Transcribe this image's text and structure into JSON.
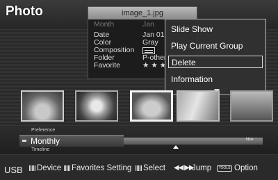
{
  "app": {
    "title": "Photo"
  },
  "file_info": {
    "filename": "image_1.jpg",
    "header_left": "Month",
    "header_right": "Jan",
    "rows": [
      {
        "label": "Date",
        "value": "Jan 01"
      },
      {
        "label": "Color",
        "value": "Gray"
      },
      {
        "label": "Composition",
        "value": ""
      },
      {
        "label": "Folder",
        "value": "P-other"
      },
      {
        "label": "Favorite",
        "value": "★ ★ ★"
      }
    ]
  },
  "tools_menu": {
    "items": [
      {
        "label": "Slide Show"
      },
      {
        "label": "Play Current Group"
      },
      {
        "label": "Delete"
      },
      {
        "label": "Information"
      }
    ],
    "selected_index": 2
  },
  "thumbnails": {
    "count": 5,
    "selected_index": 2
  },
  "preference": {
    "label": "Preference",
    "value": "Monthly"
  },
  "timeline": {
    "label": "Timeline",
    "month": "Nov"
  },
  "bottom_nav": {
    "source": "USB",
    "device": "Device",
    "favorites": "Favorites Setting",
    "select": "Select",
    "jump_arrows": "◀◀ ▶▶",
    "jump": "Jump",
    "tools_key": "TOOLS",
    "option": "Option"
  },
  "icons": [
    "down-arrow-icon",
    "composition-icon",
    "timeline-handle-icon",
    "rewind-icon",
    "forward-icon",
    "tools-key-icon"
  ]
}
